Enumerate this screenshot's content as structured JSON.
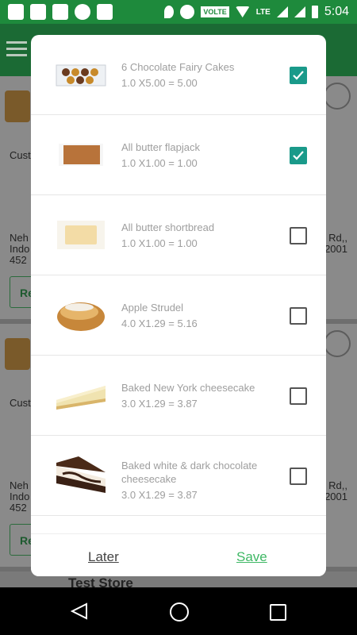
{
  "status_bar": {
    "time": "5:04",
    "volte": "VOLTE",
    "network": "LTE",
    "icons": [
      "messages-icon",
      "notification-icon",
      "notification-icon",
      "skype-icon",
      "gallery-icon",
      "location-icon",
      "alarm-icon",
      "wifi-icon",
      "signal-icon",
      "battery-charging-icon"
    ]
  },
  "background": {
    "card_text": {
      "cust": "Cust",
      "addr_left_1": "Neh",
      "addr_left_2": "Indo",
      "addr_left_3": "452",
      "addr_right_1": "Rd,,",
      "addr_right_2": "2001",
      "button": "Re"
    },
    "store_name": "Test Store"
  },
  "dialog": {
    "items": [
      {
        "name": "6 Chocolate Fairy Cakes",
        "calc": "1.0 X5.00 = 5.00",
        "checked": true,
        "image": "cupcakes-box-image"
      },
      {
        "name": "All butter flapjack",
        "calc": "1.0 X1.00 = 1.00",
        "checked": true,
        "image": "flapjack-image"
      },
      {
        "name": "All butter shortbread",
        "calc": "1.0 X1.00 = 1.00",
        "checked": false,
        "image": "shortbread-image"
      },
      {
        "name": "Apple Strudel",
        "calc": "4.0 X1.29 = 5.16",
        "checked": false,
        "image": "strudel-image"
      },
      {
        "name": "Baked New York cheesecake",
        "calc": "3.0 X1.29 = 3.87",
        "checked": false,
        "image": "cheesecake-image"
      },
      {
        "name": "Baked white & dark chocolate cheesecake",
        "calc": "3.0 X1.29 = 3.87",
        "checked": false,
        "image": "chocolate-cheesecake-image"
      }
    ],
    "later_label": "Later",
    "save_label": "Save"
  },
  "colors": {
    "accent_green": "#3fb865",
    "checkbox_teal": "#1a9a8a",
    "status_bar": "#1e8a3c"
  }
}
